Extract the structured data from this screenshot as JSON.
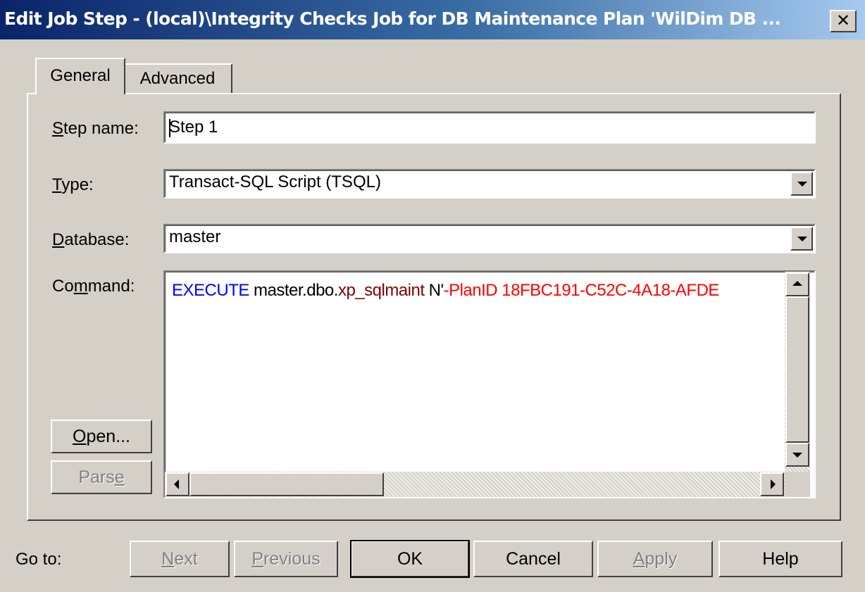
{
  "window": {
    "title": "Edit Job Step - (local)\\Integrity Checks Job for DB Maintenance Plan 'WilDim DB ...",
    "close_glyph": "✕"
  },
  "tabs": [
    {
      "label": "General",
      "selected": true
    },
    {
      "label": "Advanced",
      "selected": false
    }
  ],
  "form": {
    "step_name": {
      "label_pre": "",
      "label_u": "S",
      "label_post": "tep name:",
      "value": "Step 1"
    },
    "type": {
      "label_pre": "",
      "label_u": "T",
      "label_post": "ype:",
      "value": "Transact-SQL Script (TSQL)"
    },
    "database": {
      "label_pre": "",
      "label_u": "D",
      "label_post": "atabase:",
      "value": "master"
    },
    "command": {
      "label_pre": "Co",
      "label_u": "m",
      "label_post": "mand:",
      "tokens": [
        {
          "text": "EXECUTE",
          "color": "#0000ff"
        },
        {
          "text": " master.dbo.",
          "color": "#000000"
        },
        {
          "text": "xp_sqlmaint",
          "color": "#800000"
        },
        {
          "text": " N'",
          "color": "#000000"
        },
        {
          "text": "-PlanID 18FBC191-C52C-4A18-AFDE",
          "color": "#ff0000"
        }
      ]
    },
    "open_button": {
      "pre": "",
      "u": "O",
      "post": "pen..."
    },
    "parse_button": {
      "pre": "Pars",
      "u": "e",
      "post": "",
      "disabled": true
    }
  },
  "footer": {
    "goto_label": "Go to:",
    "next": {
      "pre": "",
      "u": "N",
      "post": "ext",
      "disabled": true
    },
    "previous": {
      "pre": "",
      "u": "P",
      "post": "revious",
      "disabled": true
    },
    "ok": "OK",
    "cancel": "Cancel",
    "apply": {
      "pre": "",
      "u": "A",
      "post": "pply",
      "disabled": true
    },
    "help": "Help"
  }
}
